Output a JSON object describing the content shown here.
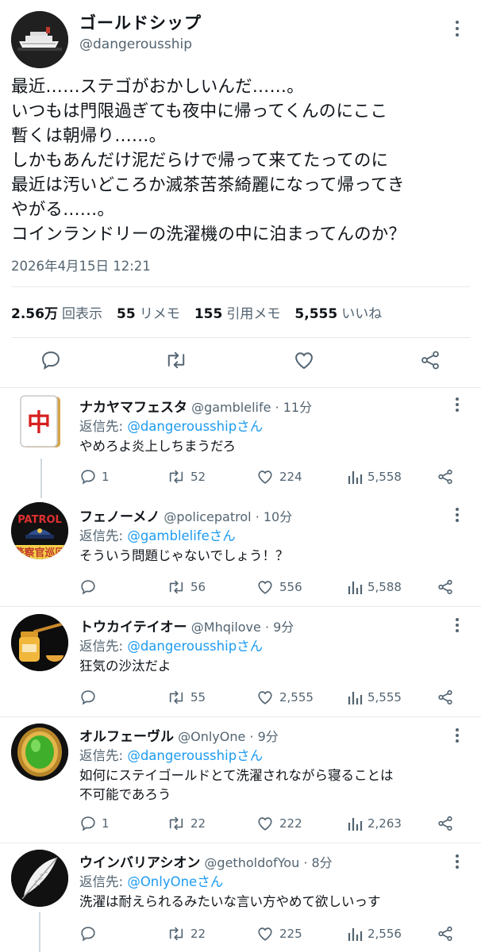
{
  "main": {
    "name": "ゴールドシップ",
    "handle": "@dangerousship",
    "text": "最近……ステゴがおかしいんだ……。\nいつもは門限過ぎても夜中に帰ってくんのにここ\n暫くは朝帰り……。\nしかもあんだけ泥だらけで帰って来てたってのに\n最近は汚いどころか滅茶苦茶綺麗になって帰ってき\nやがる……。\nコインランドリーの洗濯機の中に泊まってんのか？",
    "timestamp": "2026年4月15日 12:21",
    "stats": [
      {
        "value": "2.56万",
        "label": "回表示"
      },
      {
        "value": "55",
        "label": "リメモ"
      },
      {
        "value": "155",
        "label": "引用メモ"
      },
      {
        "value": "5,555",
        "label": "いいね"
      }
    ]
  },
  "replies": [
    {
      "name": "ナカヤマフェスタ",
      "handle": "@gamblelife",
      "time": "· 11分",
      "to_prefix": "返信先: ",
      "to": "@dangerousshipさん",
      "text": "やめろよ炎上しちまうだろ",
      "replies": "1",
      "retweets": "52",
      "likes": "224",
      "views": "5,558"
    },
    {
      "name": "フェノーメノ",
      "handle": "@policepatrol",
      "time": "· 10分",
      "to_prefix": "返信先: ",
      "to": "@gamblelifeさん",
      "text": "そういう問題じゃないでしょう！？",
      "replies": "",
      "retweets": "56",
      "likes": "556",
      "views": "5,588"
    },
    {
      "name": "トウカイテイオー",
      "handle": "@Mhqilove",
      "time": "· 9分",
      "to_prefix": "返信先: ",
      "to": "@dangerousshipさん",
      "text": "狂気の沙汰だよ",
      "replies": "",
      "retweets": "55",
      "likes": "2,555",
      "views": "5,555"
    },
    {
      "name": "オルフェーヴル",
      "handle": "@OnlyOne",
      "time": "· 9分",
      "to_prefix": "返信先: ",
      "to": "@dangerousshipさん",
      "text": "如何にステイゴールドとて洗濯されながら寝ることは\n不可能であろう",
      "replies": "1",
      "retweets": "22",
      "likes": "222",
      "views": "2,263"
    },
    {
      "name": "ウインバリアシオン",
      "handle": "@getholdofYou",
      "time": "· 8分",
      "to_prefix": "返信先: ",
      "to": "@OnlyOneさん",
      "text": "洗濯は耐えられるみたいな言い方やめて欲しいっす",
      "replies": "",
      "retweets": "22",
      "likes": "225",
      "views": "2,556"
    }
  ],
  "avatars": {
    "mahjong_tile_text": "中",
    "patrol_text": "PATROL",
    "patrol_banner_text": "警察官巡回"
  },
  "colors": {
    "accent": "#1d9bf0",
    "secondary_text": "#536471",
    "divider": "#e6e9eb"
  }
}
